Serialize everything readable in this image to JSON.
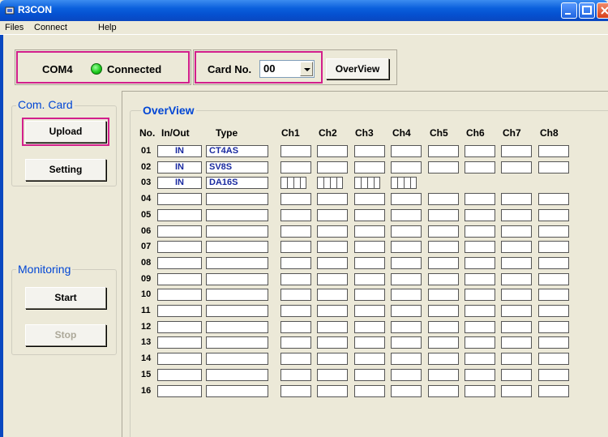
{
  "window": {
    "title": "R3CON"
  },
  "menu": [
    "Files",
    "Connect",
    "Help"
  ],
  "status": {
    "port": "COM4",
    "connection": "Connected",
    "led_color": "#22cc22"
  },
  "card": {
    "label": "Card No.",
    "value": "00",
    "overview_button": "OverView"
  },
  "com_card": {
    "title": "Com. Card",
    "upload_button": "Upload",
    "setting_button": "Setting"
  },
  "monitoring": {
    "title": "Monitoring",
    "start_button": "Start",
    "stop_button": "Stop"
  },
  "overview": {
    "title": "OverView",
    "headers": {
      "no": "No.",
      "inout": "In/Out",
      "type": "Type",
      "channels": [
        "Ch1",
        "Ch2",
        "Ch3",
        "Ch4",
        "Ch5",
        "Ch6",
        "Ch7",
        "Ch8"
      ]
    },
    "rows": [
      {
        "no": "01",
        "inout": "IN",
        "type": "CT4AS",
        "bar_channels": 0
      },
      {
        "no": "02",
        "inout": "IN",
        "type": "SV8S",
        "bar_channels": 0
      },
      {
        "no": "03",
        "inout": "IN",
        "type": "DA16S",
        "bar_channels": 4
      },
      {
        "no": "04",
        "inout": "",
        "type": "",
        "bar_channels": 0
      },
      {
        "no": "05",
        "inout": "",
        "type": "",
        "bar_channels": 0
      },
      {
        "no": "06",
        "inout": "",
        "type": "",
        "bar_channels": 0
      },
      {
        "no": "07",
        "inout": "",
        "type": "",
        "bar_channels": 0
      },
      {
        "no": "08",
        "inout": "",
        "type": "",
        "bar_channels": 0
      },
      {
        "no": "09",
        "inout": "",
        "type": "",
        "bar_channels": 0
      },
      {
        "no": "10",
        "inout": "",
        "type": "",
        "bar_channels": 0
      },
      {
        "no": "11",
        "inout": "",
        "type": "",
        "bar_channels": 0
      },
      {
        "no": "12",
        "inout": "",
        "type": "",
        "bar_channels": 0
      },
      {
        "no": "13",
        "inout": "",
        "type": "",
        "bar_channels": 0
      },
      {
        "no": "14",
        "inout": "",
        "type": "",
        "bar_channels": 0
      },
      {
        "no": "15",
        "inout": "",
        "type": "",
        "bar_channels": 0
      },
      {
        "no": "16",
        "inout": "",
        "type": "",
        "bar_channels": 0
      }
    ]
  },
  "colors": {
    "highlight": "#d21f8c",
    "group_title": "#0046d5",
    "cell_text": "#1a2aa0"
  }
}
